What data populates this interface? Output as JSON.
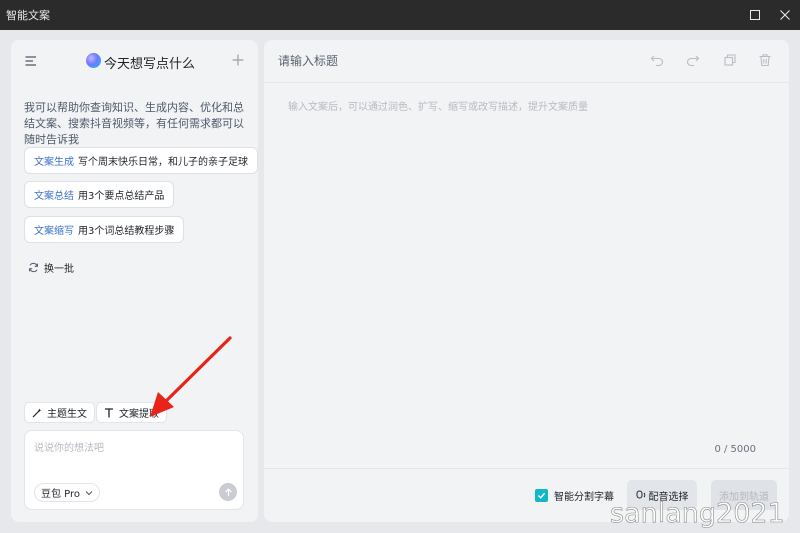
{
  "window": {
    "title": "智能文案"
  },
  "left": {
    "header_title": "今天想写点什么",
    "intro": "我可以帮助你查询知识、生成内容、优化和总结文案、搜索抖音视频等，有任何需求都可以随时告诉我",
    "suggestions": [
      {
        "kind": "文案生成",
        "text": "写个周末快乐日常，和儿子的亲子足球"
      },
      {
        "kind": "文案总结",
        "text": "用3个要点总结产品"
      },
      {
        "kind": "文案缩写",
        "text": "用3个词总结教程步骤"
      }
    ],
    "refresh_label": "换一批",
    "chips": [
      "主题生文",
      "文案提取"
    ],
    "input_placeholder": "说说你的想法吧",
    "model_label": "豆包 Pro"
  },
  "right": {
    "title_placeholder": "请输入标题",
    "body_placeholder": "输入文案后，可以通过润色、扩写、缩写或改写描述，提升文案质量",
    "counter": "0 / 5000",
    "subtitle_label": "智能分割字幕",
    "voice_label": "配音选择",
    "add_label": "添加到轨道"
  },
  "watermark": "sanlang2021",
  "colors": {
    "accent": "#13b8c8",
    "link": "#3b72c8",
    "arrow": "#e8231c"
  }
}
